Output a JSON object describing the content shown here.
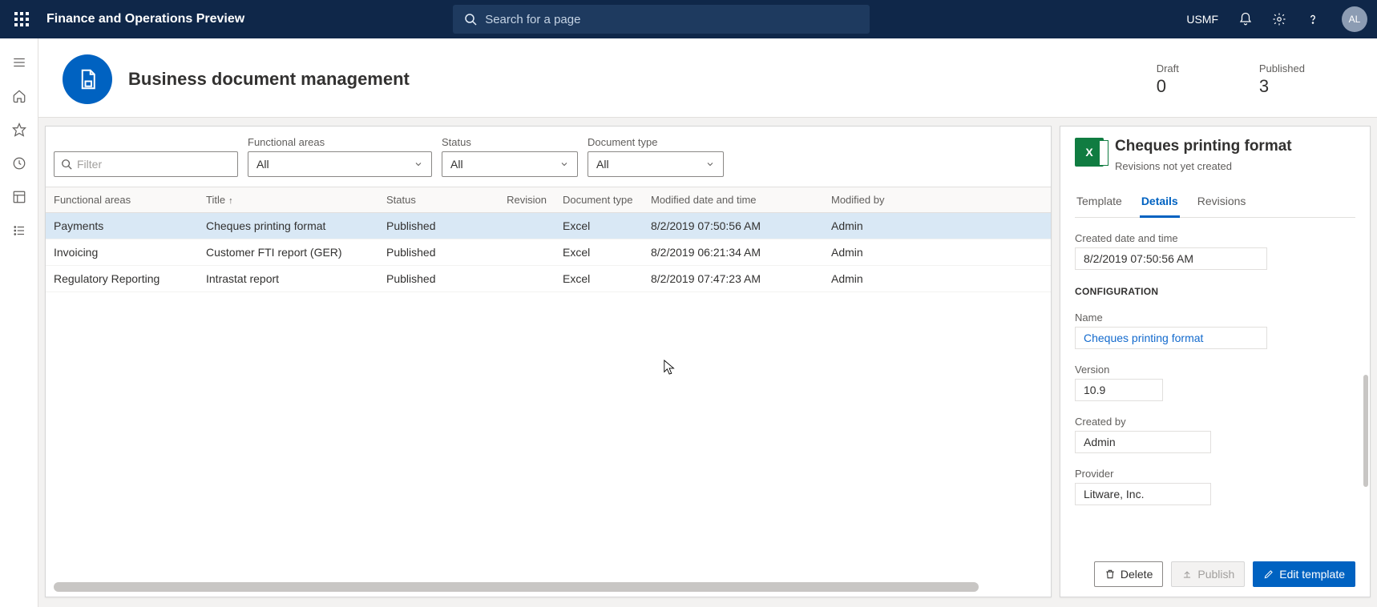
{
  "topbar": {
    "app_title": "Finance and Operations Preview",
    "search_placeholder": "Search for a page",
    "company": "USMF",
    "avatar": "AL"
  },
  "workspace": {
    "title": "Business document management",
    "stats": {
      "draft_label": "Draft",
      "draft_value": "0",
      "published_label": "Published",
      "published_value": "3"
    }
  },
  "filters": {
    "filter_placeholder": "Filter",
    "functional_areas_label": "Functional areas",
    "functional_areas_value": "All",
    "status_label": "Status",
    "status_value": "All",
    "doctype_label": "Document type",
    "doctype_value": "All"
  },
  "columns": {
    "functional_areas": "Functional areas",
    "title": "Title",
    "status": "Status",
    "revision": "Revision",
    "doctype": "Document type",
    "modified_dt": "Modified date and time",
    "modified_by": "Modified by"
  },
  "rows": [
    {
      "fa": "Payments",
      "title": "Cheques printing format",
      "status": "Published",
      "rev": "",
      "doctype": "Excel",
      "mdt": "8/2/2019 07:50:56 AM",
      "mby": "Admin",
      "selected": true
    },
    {
      "fa": "Invoicing",
      "title": "Customer FTI report (GER)",
      "status": "Published",
      "rev": "",
      "doctype": "Excel",
      "mdt": "8/2/2019 06:21:34 AM",
      "mby": "Admin",
      "selected": false
    },
    {
      "fa": "Regulatory Reporting",
      "title": "Intrastat report",
      "status": "Published",
      "rev": "",
      "doctype": "Excel",
      "mdt": "8/2/2019 07:47:23 AM",
      "mby": "Admin",
      "selected": false
    }
  ],
  "details": {
    "title": "Cheques printing format",
    "subtitle": "Revisions not yet created",
    "tabs": {
      "template": "Template",
      "details": "Details",
      "revisions": "Revisions"
    },
    "created_label": "Created date and time",
    "created_value": "8/2/2019 07:50:56 AM",
    "config_section": "CONFIGURATION",
    "name_label": "Name",
    "name_value": "Cheques printing format",
    "version_label": "Version",
    "version_value": "10.9",
    "createdby_label": "Created by",
    "createdby_value": "Admin",
    "provider_label": "Provider",
    "provider_value": "Litware, Inc.",
    "delete_label": "Delete",
    "publish_label": "Publish",
    "edit_label": "Edit template"
  }
}
